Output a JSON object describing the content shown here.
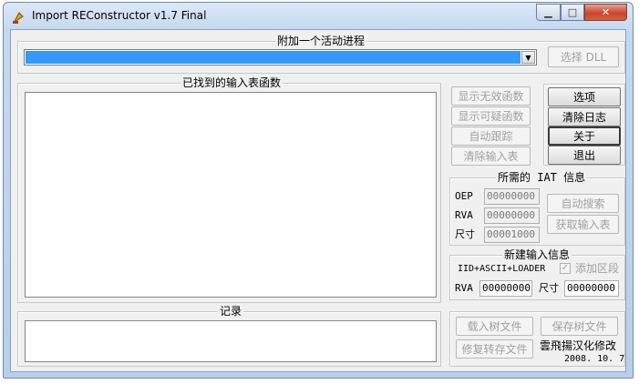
{
  "window": {
    "title": "Import REConstructor v1.7 Final",
    "min_glyph": "▁",
    "max_glyph": "□",
    "close_glyph": "✕"
  },
  "attach": {
    "group_label": "附加一个活动进程",
    "select_dll_label": "选择 DLL",
    "dropdown_arrow": "▼"
  },
  "imports": {
    "group_label": "已找到的输入表函数"
  },
  "import_buttons": {
    "show_invalid": "显示无效函数",
    "show_suspect": "显示可疑函数",
    "auto_trace": "自动跟踪",
    "clear_imports": "清除输入表"
  },
  "main_buttons": {
    "options": "选项",
    "clear_log": "清除日志",
    "about": "关于",
    "exit": "退出"
  },
  "iat_info": {
    "group_label": "所需的 IAT 信息",
    "oep_label": "OEP",
    "oep_value": "00000000",
    "rva_label": "RVA",
    "rva_value": "00000000",
    "size_label": "尺寸",
    "size_value": "00001000",
    "auto_search": "自动搜索",
    "get_imports": "获取输入表"
  },
  "new_import": {
    "group_label": "新建输入信息",
    "format_text": "IID+ASCII+LOADER",
    "add_section_label": "添加区段",
    "rva_label": "RVA",
    "rva_value": "00000000",
    "size_label": "尺寸",
    "size_value": "00000000"
  },
  "log": {
    "group_label": "记录"
  },
  "tree_buttons": {
    "load_tree": "载入树文件",
    "save_tree": "保存树文件",
    "fix_dump": "修复转存文件"
  },
  "credit": {
    "translator": "雲飛揚汉化修改",
    "date": "2008. 10. 7"
  }
}
